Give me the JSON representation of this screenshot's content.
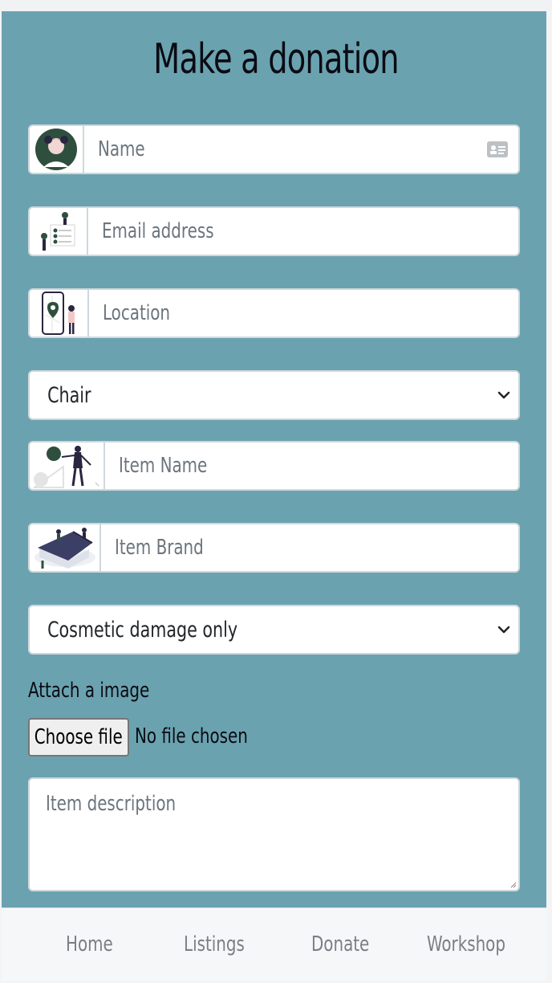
{
  "page": {
    "title": "Make a donation"
  },
  "form": {
    "name_placeholder": "Name",
    "email_placeholder": "Email address",
    "location_placeholder": "Location",
    "category_selected": "Chair",
    "item_name_placeholder": "Item Name",
    "item_brand_placeholder": "Item Brand",
    "condition_selected": "Cosmetic damage only",
    "attach_label": "Attach a image",
    "file_button_label": "Choose file",
    "file_status": "No file chosen",
    "description_placeholder": "Item description"
  },
  "nav": {
    "items": [
      "Home",
      "Listings",
      "Donate",
      "Workshop"
    ]
  },
  "icons": {
    "name_addon": "avatar-illustration-icon",
    "email_addon": "email-illustration-icon",
    "location_addon": "map-pin-illustration-icon",
    "item_name_addon": "shapes-illustration-icon",
    "item_brand_addon": "house-illustration-icon",
    "name_field_badge": "id-card-icon",
    "select_arrow": "chevron-down-icon"
  },
  "colors": {
    "panel": "#6aa3af",
    "accent_green": "#2f4f3e",
    "nav_bg": "#f6f7f9"
  }
}
